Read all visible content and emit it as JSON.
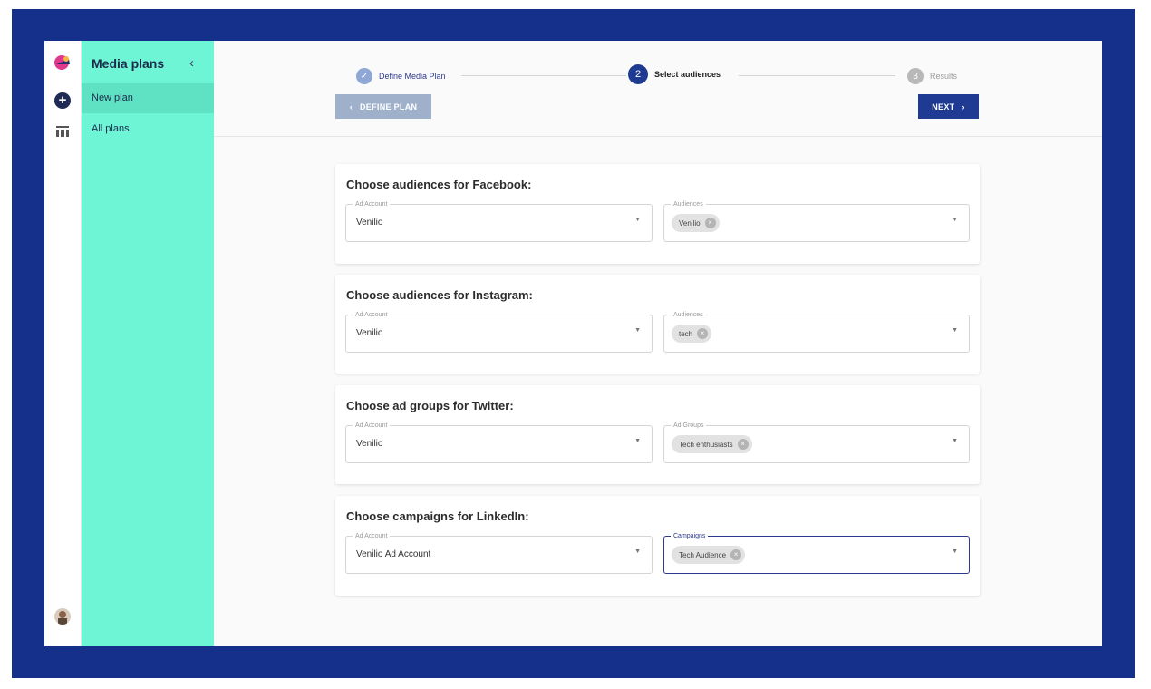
{
  "sidenav": {
    "title": "Media plans",
    "items": [
      {
        "label": "New plan"
      },
      {
        "label": "All plans"
      }
    ]
  },
  "stepper": {
    "steps": [
      {
        "label": "Define Media Plan",
        "number": "",
        "state": "completed"
      },
      {
        "label": "Select audiences",
        "number": "2",
        "state": "active"
      },
      {
        "label": "Results",
        "number": "3",
        "state": "pending"
      }
    ],
    "back_label": "DEFINE PLAN",
    "next_label": "NEXT"
  },
  "cards": [
    {
      "title": "Choose audiences for Facebook:",
      "account_legend": "Ad Account",
      "account_value": "Venilio",
      "select_legend": "Audiences",
      "chip": "Venilio"
    },
    {
      "title": "Choose audiences for Instagram:",
      "account_legend": "Ad Account",
      "account_value": "Venilio",
      "select_legend": "Audiences",
      "chip": "tech"
    },
    {
      "title": "Choose ad groups for Twitter:",
      "account_legend": "Ad Account",
      "account_value": "Venilio",
      "select_legend": "Ad Groups",
      "chip": "Tech enthusiasts"
    },
    {
      "title": "Choose campaigns for LinkedIn:",
      "account_legend": "Ad Account",
      "account_value": "Venilio Ad Account",
      "select_legend": "Campaigns",
      "chip": "Tech Audience"
    }
  ],
  "colors": {
    "frame": "#14308a",
    "sidenav": "#6ef5d6",
    "primary": "#1f3a93",
    "back_button": "#9fb0cb"
  },
  "icons": {
    "back": "chevron-left-icon",
    "next": "chevron-right-icon",
    "remove_chip": "cancel-icon",
    "dropdown": "caret-down-icon"
  }
}
